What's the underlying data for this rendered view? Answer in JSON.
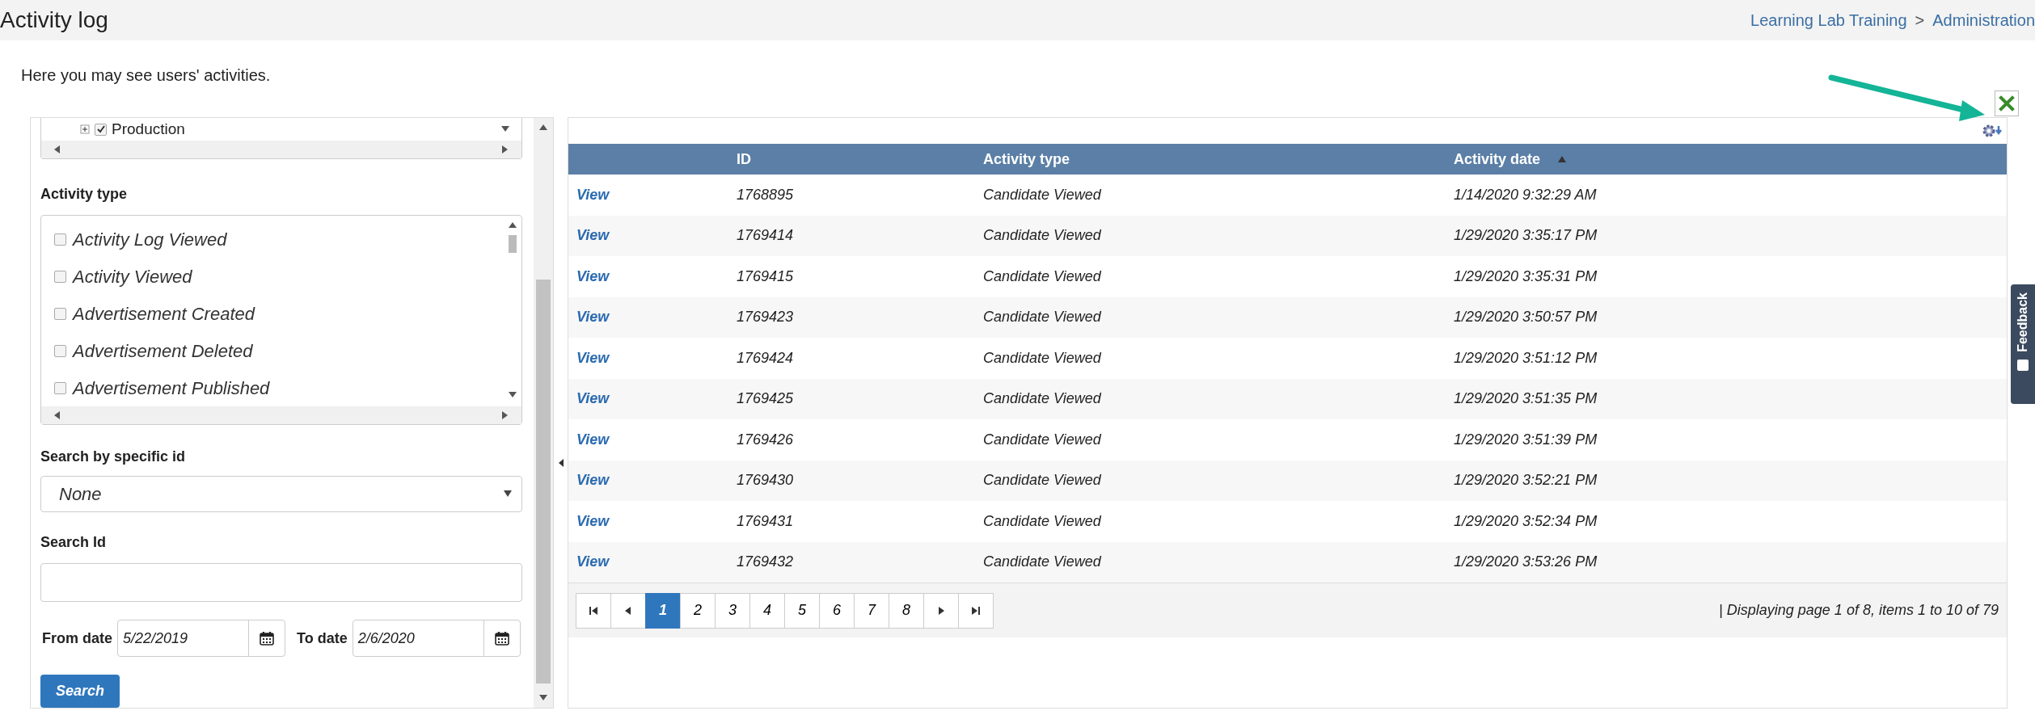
{
  "header": {
    "title": "Activity log",
    "breadcrumb": [
      "Learning Lab Training",
      "Administration"
    ],
    "separator": ">"
  },
  "intro": "Here you may see users' activities.",
  "tree": [
    {
      "label": "Production",
      "checked": true,
      "expanded": false
    }
  ],
  "activity_type": {
    "label": "Activity type",
    "items": [
      {
        "label": "Activity Log Viewed",
        "checked": false
      },
      {
        "label": "Activity Viewed",
        "checked": false
      },
      {
        "label": "Advertisement Created",
        "checked": false
      },
      {
        "label": "Advertisement Deleted",
        "checked": false
      },
      {
        "label": "Advertisement Published",
        "checked": false
      }
    ]
  },
  "search_by_id": {
    "label": "Search by specific id",
    "value": "None"
  },
  "search_id": {
    "label": "Search Id"
  },
  "from_date": {
    "label": "From date",
    "value": "5/22/2019"
  },
  "to_date": {
    "label": "To date",
    "value": "2/6/2020"
  },
  "search_button": "Search",
  "table": {
    "columns": [
      {
        "label": "ID"
      },
      {
        "label": "Activity type"
      },
      {
        "label": "Activity date",
        "sort_ascending": true
      }
    ],
    "rows": [
      {
        "link": "View",
        "id": "1768895",
        "type": "Candidate Viewed",
        "date": "1/14/2020 9:32:29 AM"
      },
      {
        "link": "View",
        "id": "1769414",
        "type": "Candidate Viewed",
        "date": "1/29/2020 3:35:17 PM"
      },
      {
        "link": "View",
        "id": "1769415",
        "type": "Candidate Viewed",
        "date": "1/29/2020 3:35:31 PM"
      },
      {
        "link": "View",
        "id": "1769423",
        "type": "Candidate Viewed",
        "date": "1/29/2020 3:50:57 PM"
      },
      {
        "link": "View",
        "id": "1769424",
        "type": "Candidate Viewed",
        "date": "1/29/2020 3:51:12 PM"
      },
      {
        "link": "View",
        "id": "1769425",
        "type": "Candidate Viewed",
        "date": "1/29/2020 3:51:35 PM"
      },
      {
        "link": "View",
        "id": "1769426",
        "type": "Candidate Viewed",
        "date": "1/29/2020 3:51:39 PM"
      },
      {
        "link": "View",
        "id": "1769430",
        "type": "Candidate Viewed",
        "date": "1/29/2020 3:52:21 PM"
      },
      {
        "link": "View",
        "id": "1769431",
        "type": "Candidate Viewed",
        "date": "1/29/2020 3:52:34 PM"
      },
      {
        "link": "View",
        "id": "1769432",
        "type": "Candidate Viewed",
        "date": "1/29/2020 3:53:26 PM"
      }
    ]
  },
  "pagination": {
    "pages": [
      {
        "label": "1",
        "selected": true
      },
      {
        "label": "2",
        "selected": false
      },
      {
        "label": "3",
        "selected": false
      },
      {
        "label": "4",
        "selected": false
      },
      {
        "label": "5",
        "selected": false
      },
      {
        "label": "6",
        "selected": false
      },
      {
        "label": "7",
        "selected": false
      },
      {
        "label": "8",
        "selected": false
      }
    ],
    "status": "| Displaying page 1 of 8, items 1 to 10 of 79"
  },
  "feedback_tab": "Feedback"
}
